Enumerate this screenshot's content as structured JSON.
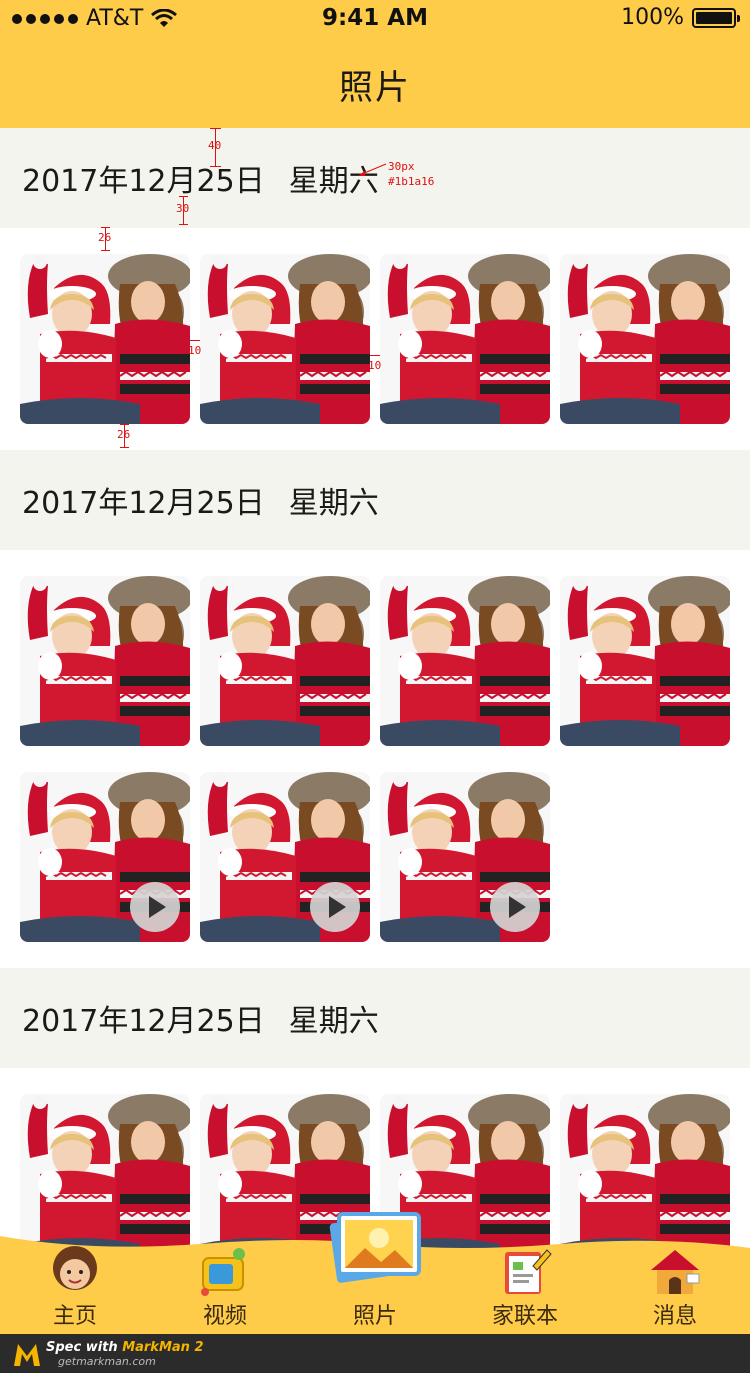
{
  "status_bar": {
    "carrier": "AT&T",
    "time": "9:41 AM",
    "battery": "100%"
  },
  "nav": {
    "title": "照片"
  },
  "sections": [
    {
      "date": "2017年12月25日",
      "weekday": "星期六",
      "items": [
        false,
        false,
        false,
        false
      ]
    },
    {
      "date": "2017年12月25日",
      "weekday": "星期六",
      "items": [
        false,
        false,
        false,
        false,
        true,
        true,
        true
      ]
    },
    {
      "date": "2017年12月25日",
      "weekday": "星期六",
      "items": [
        false,
        false,
        false,
        false
      ]
    }
  ],
  "annotations": {
    "spacing_40": "40",
    "spacing_30": "30",
    "spacing_26_top": "26",
    "spacing_26_bottom": "26",
    "gap_10_a": "10",
    "gap_10_b": "10",
    "font_size": "30px",
    "font_color": "#1b1a16"
  },
  "tabs": [
    {
      "label": "主页",
      "icon": "home-avatar-icon",
      "active": false
    },
    {
      "label": "视频",
      "icon": "video-tv-icon",
      "active": false
    },
    {
      "label": "照片",
      "icon": "photo-frame-icon",
      "active": true
    },
    {
      "label": "家联本",
      "icon": "notebook-icon",
      "active": false
    },
    {
      "label": "消息",
      "icon": "message-house-icon",
      "active": false
    }
  ],
  "footer": {
    "brand_prefix": "Spec with ",
    "brand": "MarkMan 2",
    "url": "getmarkman.com"
  },
  "colors": {
    "accent": "#ffcc4a",
    "header_bg": "#f4f4ee",
    "text": "#1b1a16",
    "annotation": "#dd1111"
  }
}
